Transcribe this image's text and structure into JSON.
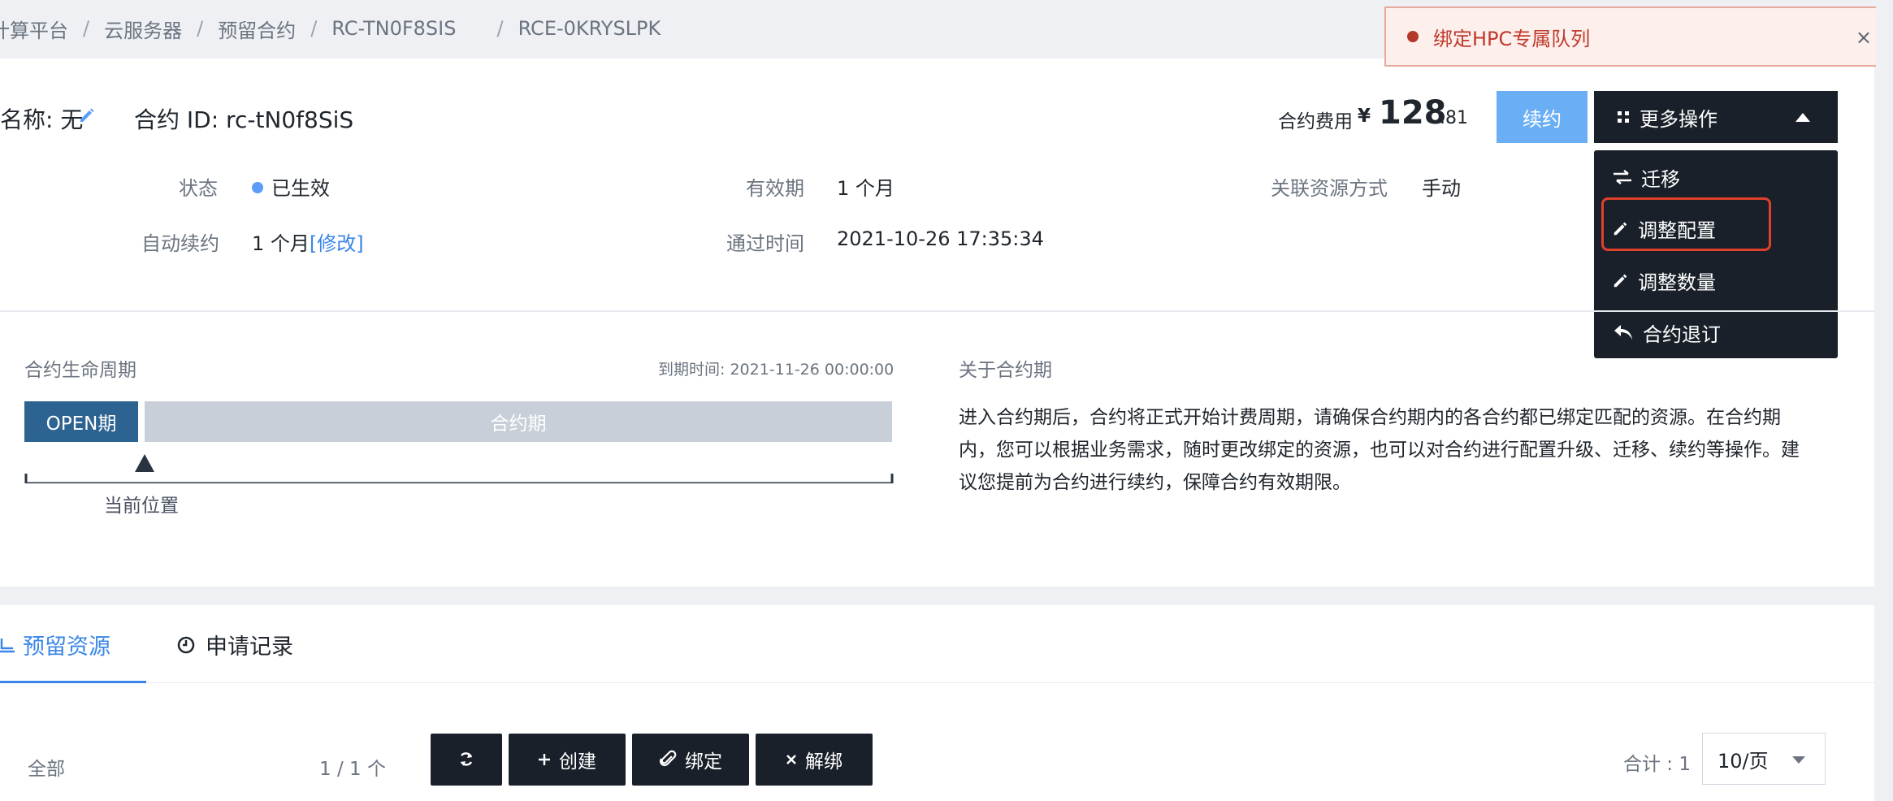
{
  "breadcrumb": {
    "items": [
      "计算平台",
      "云服务器",
      "预留合约",
      "RC-TN0F8SIS",
      "RCE-0KRYSLPK"
    ],
    "separator": "/"
  },
  "header": {
    "name_label": "名称: 无",
    "contract_id": "合约 ID: rc-tN0f8SiS",
    "fee_label": "合约费用",
    "fee_currency": "¥",
    "fee_integer": "128",
    "fee_decimal": ".81",
    "renew_button": "续约",
    "more_actions_button": "更多操作"
  },
  "more_menu": {
    "items": [
      {
        "label": "迁移",
        "icon": "swap-arrows-icon"
      },
      {
        "label": "调整配置",
        "icon": "pencil-icon",
        "highlighted": true
      },
      {
        "label": "调整数量",
        "icon": "pencil-icon"
      },
      {
        "label": "合约退订",
        "icon": "reply-arrow-icon"
      }
    ]
  },
  "info": {
    "status_label": "状态",
    "status_value": "已生效",
    "status_color": "#5a9cf8",
    "validity_label": "有效期",
    "validity_value": "1 个月",
    "binding_label": "关联资源方式",
    "binding_value": "手动",
    "auto_renew_label": "自动续约",
    "auto_renew_value": "1 个月",
    "auto_renew_modify": "[修改]",
    "approved_label": "通过时间",
    "approved_value": "2021-10-26 17:35:34"
  },
  "lifecycle": {
    "title": "合约生命周期",
    "expire": "到期时间: 2021-11-26 00:00:00",
    "open_phase": "OPEN期",
    "contract_phase": "合约期",
    "current_position": "当前位置"
  },
  "about": {
    "title": "关于合约期",
    "text": "进入合约期后，合约将正式开始计费周期，请确保合约期内的各合约都已绑定匹配的资源。在合约期内，您可以根据业务需求，随时更改绑定的资源，也可以对合约进行配置升级、迁移、续约等操作。建议您提前为合约进行续约，保障合约有效期限。"
  },
  "tabs": [
    {
      "label": "预留资源",
      "icon": "monitor-icon",
      "active": true
    },
    {
      "label": "申请记录",
      "icon": "clock-icon",
      "active": false
    }
  ],
  "toolbar": {
    "filter_all": "全部",
    "filter_count": "1 / 1 个",
    "create": "创建",
    "bind": "绑定",
    "unbind": "解绑",
    "total": "合计 : 1",
    "page_size": "10/页"
  },
  "toast": {
    "message": "绑定HPC专属队列",
    "close": "×"
  },
  "colors": {
    "primary_dark": "#1a2029",
    "accent_blue": "#3a86e8",
    "renew_blue": "#6aaef6",
    "open_phase": "#2d6391",
    "highlight_red": "#e0412c"
  }
}
